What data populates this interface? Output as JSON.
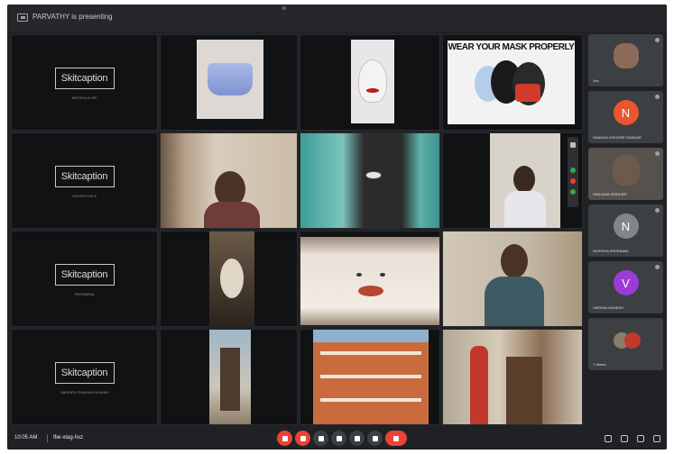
{
  "topbar": {
    "presenting_label": "PARVATHY is presenting"
  },
  "tiles": [
    {
      "id": "r1c1",
      "kind": "logo",
      "logo": "Skitcaption",
      "sub": "MRITHULA SRI"
    },
    {
      "id": "r2c1",
      "kind": "logo",
      "logo": "Skitcaption",
      "sub": "HARSHITHA S"
    },
    {
      "id": "r3c1",
      "kind": "logo",
      "logo": "Skitcaption",
      "sub": "POORNIMA"
    },
    {
      "id": "r4c1",
      "kind": "logo",
      "logo": "Skitcaption",
      "sub": "ABISHEK PRAKASH KUMAR"
    }
  ],
  "poster": {
    "text": "WEAR YOUR MASK PROPERLY"
  },
  "participants": [
    {
      "name": "You",
      "initial": "",
      "color": "#8b6a5a"
    },
    {
      "name": "NANDHA KISHORE SUNDAR",
      "initial": "N",
      "color": "#e8572d"
    },
    {
      "name": "SANJANA SRIDHAR",
      "initial": "",
      "color": "#6e5a4a"
    },
    {
      "name": "NIVEDHA KRISHNAN",
      "initial": "N",
      "color": "#80868b"
    },
    {
      "name": "VARSHA GANESH",
      "initial": "V",
      "color": "#9c3cd6"
    },
    {
      "name": "7 others",
      "initial": "",
      "color": "#c0392b"
    }
  ],
  "bottombar": {
    "time": "10:05 AM",
    "meeting_code": "fbe-xtag-hxz"
  }
}
